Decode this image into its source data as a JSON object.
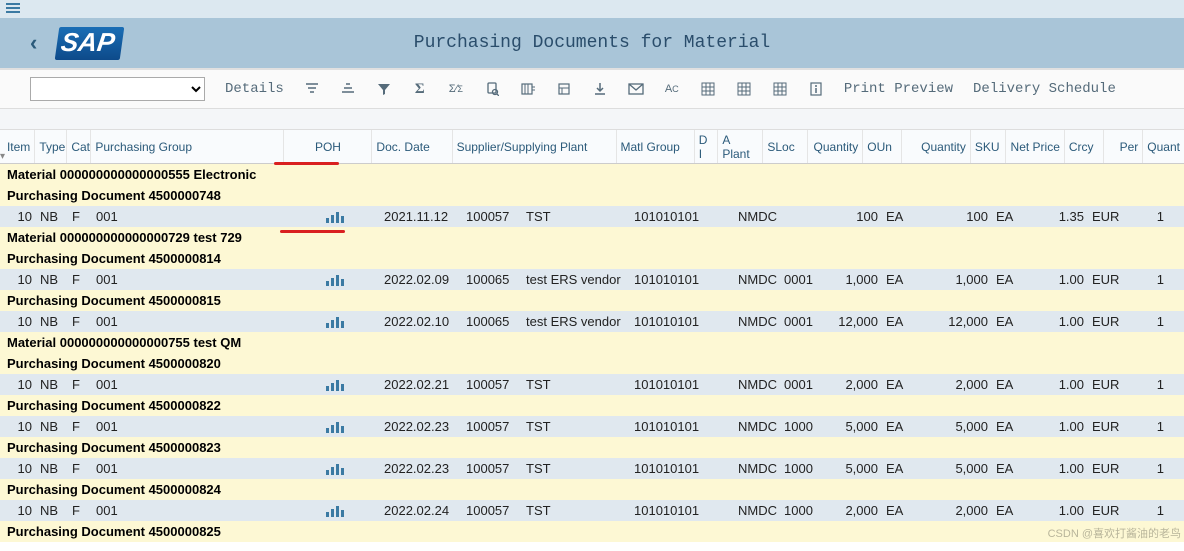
{
  "header": {
    "title": "Purchasing Documents for Material",
    "logo": "SAP"
  },
  "toolbar": {
    "details": "Details",
    "print_preview": "Print Preview",
    "delivery_schedule": "Delivery Schedule"
  },
  "columns": {
    "item": "Item",
    "type": "Type",
    "cat": "Cat",
    "pgrp": "Purchasing Group",
    "poh": "POH",
    "docdate": "Doc. Date",
    "supplier": "Supplier/Supplying Plant",
    "matg": "Matl Group",
    "di": "D I",
    "aplant": "A Plant",
    "sloc": "SLoc",
    "qty": "Quantity",
    "oun": "OUn",
    "qtysku": "Quantity",
    "sku": "SKU",
    "netprice": "Net Price",
    "crcy": "Crcy",
    "per": "Per",
    "quant": "Quant"
  },
  "groups": [
    {
      "material": "Material 000000000000000555 Electronic",
      "docs": [
        {
          "label": "Purchasing Document 4500000748",
          "rows": [
            {
              "item": "10",
              "type": "NB",
              "cat": "F",
              "pgrp": "001",
              "docdate": "2021.11.12",
              "supplier": "100057",
              "sname": "TST",
              "matg": "101010101",
              "aplant": "NMDC",
              "sloc": "",
              "qty": "100",
              "oun": "EA",
              "qtysku": "100",
              "sku": "EA",
              "price": "1.35",
              "crcy": "EUR",
              "per": "1"
            }
          ]
        }
      ]
    },
    {
      "material": "Material 000000000000000729 test 729",
      "docs": [
        {
          "label": "Purchasing Document 4500000814",
          "rows": [
            {
              "item": "10",
              "type": "NB",
              "cat": "F",
              "pgrp": "001",
              "docdate": "2022.02.09",
              "supplier": "100065",
              "sname": "test ERS vendor",
              "matg": "101010101",
              "aplant": "NMDC",
              "sloc": "0001",
              "qty": "1,000",
              "oun": "EA",
              "qtysku": "1,000",
              "sku": "EA",
              "price": "1.00",
              "crcy": "EUR",
              "per": "1"
            }
          ]
        },
        {
          "label": "Purchasing Document 4500000815",
          "rows": [
            {
              "item": "10",
              "type": "NB",
              "cat": "F",
              "pgrp": "001",
              "docdate": "2022.02.10",
              "supplier": "100065",
              "sname": "test ERS vendor",
              "matg": "101010101",
              "aplant": "NMDC",
              "sloc": "0001",
              "qty": "12,000",
              "oun": "EA",
              "qtysku": "12,000",
              "sku": "EA",
              "price": "1.00",
              "crcy": "EUR",
              "per": "1"
            }
          ]
        }
      ]
    },
    {
      "material": "Material 000000000000000755 test QM",
      "docs": [
        {
          "label": "Purchasing Document 4500000820",
          "rows": [
            {
              "item": "10",
              "type": "NB",
              "cat": "F",
              "pgrp": "001",
              "docdate": "2022.02.21",
              "supplier": "100057",
              "sname": "TST",
              "matg": "101010101",
              "aplant": "NMDC",
              "sloc": "0001",
              "qty": "2,000",
              "oun": "EA",
              "qtysku": "2,000",
              "sku": "EA",
              "price": "1.00",
              "crcy": "EUR",
              "per": "1"
            }
          ]
        },
        {
          "label": "Purchasing Document 4500000822",
          "rows": [
            {
              "item": "10",
              "type": "NB",
              "cat": "F",
              "pgrp": "001",
              "docdate": "2022.02.23",
              "supplier": "100057",
              "sname": "TST",
              "matg": "101010101",
              "aplant": "NMDC",
              "sloc": "1000",
              "qty": "5,000",
              "oun": "EA",
              "qtysku": "5,000",
              "sku": "EA",
              "price": "1.00",
              "crcy": "EUR",
              "per": "1"
            }
          ]
        },
        {
          "label": "Purchasing Document 4500000823",
          "rows": [
            {
              "item": "10",
              "type": "NB",
              "cat": "F",
              "pgrp": "001",
              "docdate": "2022.02.23",
              "supplier": "100057",
              "sname": "TST",
              "matg": "101010101",
              "aplant": "NMDC",
              "sloc": "1000",
              "qty": "5,000",
              "oun": "EA",
              "qtysku": "5,000",
              "sku": "EA",
              "price": "1.00",
              "crcy": "EUR",
              "per": "1"
            }
          ]
        },
        {
          "label": "Purchasing Document 4500000824",
          "rows": [
            {
              "item": "10",
              "type": "NB",
              "cat": "F",
              "pgrp": "001",
              "docdate": "2022.02.24",
              "supplier": "100057",
              "sname": "TST",
              "matg": "101010101",
              "aplant": "NMDC",
              "sloc": "1000",
              "qty": "2,000",
              "oun": "EA",
              "qtysku": "2,000",
              "sku": "EA",
              "price": "1.00",
              "crcy": "EUR",
              "per": "1"
            }
          ]
        },
        {
          "label": "Purchasing Document 4500000825",
          "rows": []
        }
      ]
    }
  ],
  "watermark": "CSDN @喜欢打酱油的老鸟"
}
